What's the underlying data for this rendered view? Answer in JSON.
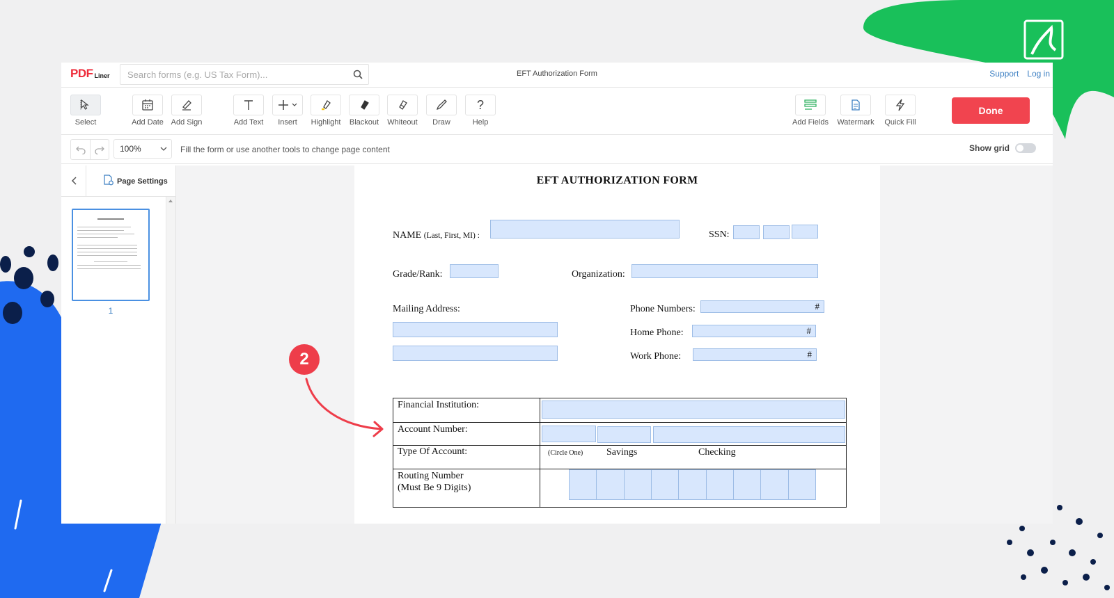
{
  "app": {
    "logo": {
      "part1": "PDF",
      "part2": "",
      "suffix": "Liner"
    },
    "search": {
      "placeholder": "Search forms (e.g. US Tax Form)..."
    },
    "doc_title": "EFT Authorization Form",
    "links": {
      "support": "Support",
      "login": "Log in"
    }
  },
  "toolbar": {
    "select": "Select",
    "add_date": "Add Date",
    "add_sign": "Add Sign",
    "add_text": "Add Text",
    "insert": "Insert",
    "highlight": "Highlight",
    "blackout": "Blackout",
    "whiteout": "Whiteout",
    "draw": "Draw",
    "help": "Help",
    "add_fields": "Add Fields",
    "watermark": "Watermark",
    "quick_fill": "Quick Fill",
    "done": "Done"
  },
  "subbar": {
    "zoom": "100%",
    "hint": "Fill the form or use another tools to change page content",
    "show_grid": "Show grid"
  },
  "sidebar": {
    "page_settings": "Page Settings",
    "page_number": "1"
  },
  "form": {
    "title": "EFT AUTHORIZATION FORM",
    "name_label": "NAME",
    "name_hint": "(Last, First, MI) :",
    "ssn_label": "SSN:",
    "grade_label": "Grade/Rank:",
    "org_label": "Organization:",
    "mailing_label": "Mailing Address:",
    "phone_numbers_label": "Phone Numbers:",
    "home_phone_label": "Home Phone:",
    "work_phone_label": "Work  Phone:",
    "bank": {
      "fin_inst": "Financial Institution:",
      "account_number": "Account Number:",
      "type_of_account": "Type Of Account:",
      "circle_one": "(Circle One)",
      "savings": "Savings",
      "checking": "Checking",
      "routing_line1": "Routing Number",
      "routing_line2": "(Must Be 9 Digits)"
    }
  },
  "annotation": {
    "step": "2"
  },
  "colors": {
    "accent_red": "#f1444f",
    "link_blue": "#3c7fc2",
    "field_blue": "#d8e7fd",
    "brand_green": "#19c05a",
    "brand_blue": "#1f6af0"
  }
}
